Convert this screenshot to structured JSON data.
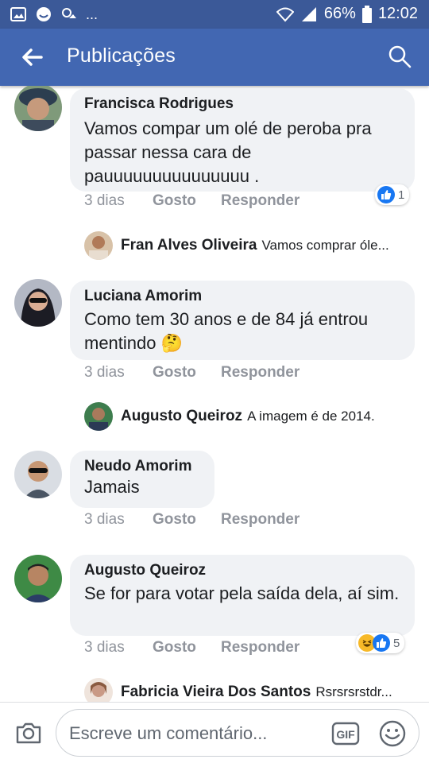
{
  "status": {
    "battery": "66%",
    "time": "12:02",
    "more": "..."
  },
  "header": {
    "title": "Publicações"
  },
  "comments": [
    {
      "author": "Francisca Rodrigues",
      "text": "Vamos compar um olé de peroba pra passar nessa cara de pauuuuuuuuuuuuuuu .",
      "time": "3 dias",
      "like": "Gosto",
      "reply": "Responder",
      "reaction_count": "1",
      "reply_preview": {
        "author": "Fran Alves Oliveira",
        "text": "Vamos comprar óle..."
      }
    },
    {
      "author": "Luciana Amorim",
      "text": "Como tem 30 anos e de 84 já entrou mentindo 🤔",
      "time": "3 dias",
      "like": "Gosto",
      "reply": "Responder",
      "reply_preview": {
        "author": "Augusto Queiroz",
        "text": "A imagem é de 2014."
      }
    },
    {
      "author": "Neudo Amorim",
      "text": "Jamais",
      "time": "3 dias",
      "like": "Gosto",
      "reply": "Responder"
    },
    {
      "author": "Augusto Queiroz",
      "text": "Se for para votar pela saída dela, aí sim.",
      "time": "3 dias",
      "like": "Gosto",
      "reply": "Responder",
      "reaction_count": "5",
      "reply_preview": {
        "author": "Fabricia Vieira Dos Santos",
        "text": "Rsrsrsrstdr..."
      }
    }
  ],
  "composer": {
    "placeholder": "Escreve um comentário...",
    "gif_label": "GIF"
  },
  "colors": {
    "bar": "#4267b2",
    "statusbar": "#3b5998",
    "like_blue": "#1877f2",
    "bubble": "#f0f2f5"
  },
  "icons": [
    "gallery-icon",
    "face-icon",
    "dot-icon",
    "wifi-icon",
    "signal-icon",
    "battery-icon",
    "back-arrow-icon",
    "search-icon",
    "like-icon",
    "haha-icon",
    "camera-icon",
    "gif-icon",
    "emoji-icon"
  ]
}
